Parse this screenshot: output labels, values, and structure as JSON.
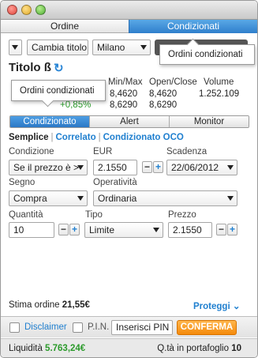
{
  "tabs": {
    "ordine": "Ordine",
    "condizionati": "Condizionati"
  },
  "toolbar": {
    "cambia_titolo": "Cambia titolo",
    "market": "Milano"
  },
  "tooltips": {
    "top": "Ordini condizionati",
    "left": "Ordini condizionati"
  },
  "titolo": {
    "name": "Titolo ß",
    "refresh_icon": "↻"
  },
  "quote": {
    "headers": {
      "minmax": "Min/Max",
      "openclose": "Open/Close",
      "volume": "Volume"
    },
    "change": "+0,85%",
    "min": "8,4620",
    "max": "8,6290",
    "open": "8,4620",
    "close": "8,6290",
    "volume": "1.252.109"
  },
  "segments": {
    "condizionato": "Condizionato",
    "alert": "Alert",
    "monitor": "Monitor"
  },
  "subtabs": {
    "semplice": "Semplice",
    "correlato": "Correlato",
    "oco": "Condizionato OCO",
    "sep": "|"
  },
  "form": {
    "condizione_label": "Condizione",
    "condizione_value": "Se il prezzo è >",
    "eur_label": "EUR",
    "eur_value": "2.1550",
    "scadenza_label": "Scadenza",
    "scadenza_value": "22/06/2012",
    "segno_label": "Segno",
    "segno_value": "Compra",
    "operativita_label": "Operatività",
    "operativita_value": "Ordinaria",
    "quantita_label": "Quantità",
    "quantita_value": "10",
    "tipo_label": "Tipo",
    "tipo_value": "Limite",
    "prezzo_label": "Prezzo",
    "prezzo_value": "2.1550",
    "minus": "−",
    "plus": "+"
  },
  "summary": {
    "stima_label": "Stima ordine",
    "stima_value": "21,55€",
    "proteggi": "Proteggi ⌄"
  },
  "bottom": {
    "disclaimer": "Disclaimer",
    "pin_label": "P.I.N.",
    "pin_placeholder": "Inserisci PIN",
    "confirm": "CONFERMA"
  },
  "footer": {
    "liquidita_label": "Liquidità",
    "liquidita_value": "5.763,24€",
    "portafoglio_label": "Q.tà in portafoglio",
    "portafoglio_value": "10"
  },
  "colors": {
    "accent": "#2f7fcc",
    "confirm": "#f58a0b",
    "positive": "#2c9b2c"
  }
}
